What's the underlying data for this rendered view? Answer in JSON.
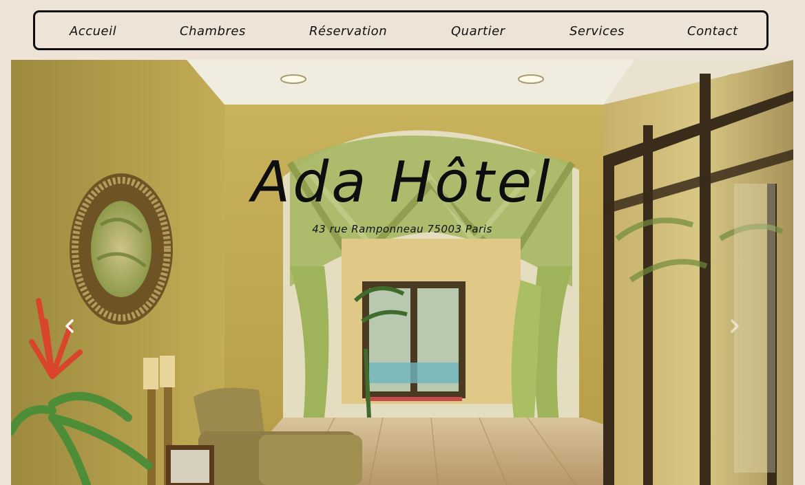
{
  "nav": {
    "items": [
      {
        "label": "Accueil"
      },
      {
        "label": "Chambres"
      },
      {
        "label": "Réservation"
      },
      {
        "label": "Quartier"
      },
      {
        "label": "Services"
      },
      {
        "label": "Contact"
      }
    ]
  },
  "hero": {
    "title": "Ada Hôtel",
    "address": "43 rue Ramponneau 75003 Paris",
    "prev_icon": "chevron-left-icon",
    "next_icon": "chevron-right-icon"
  },
  "colors": {
    "page_background": "#ede3d6",
    "nav_border": "#0d0d0d",
    "text": "#111111"
  }
}
